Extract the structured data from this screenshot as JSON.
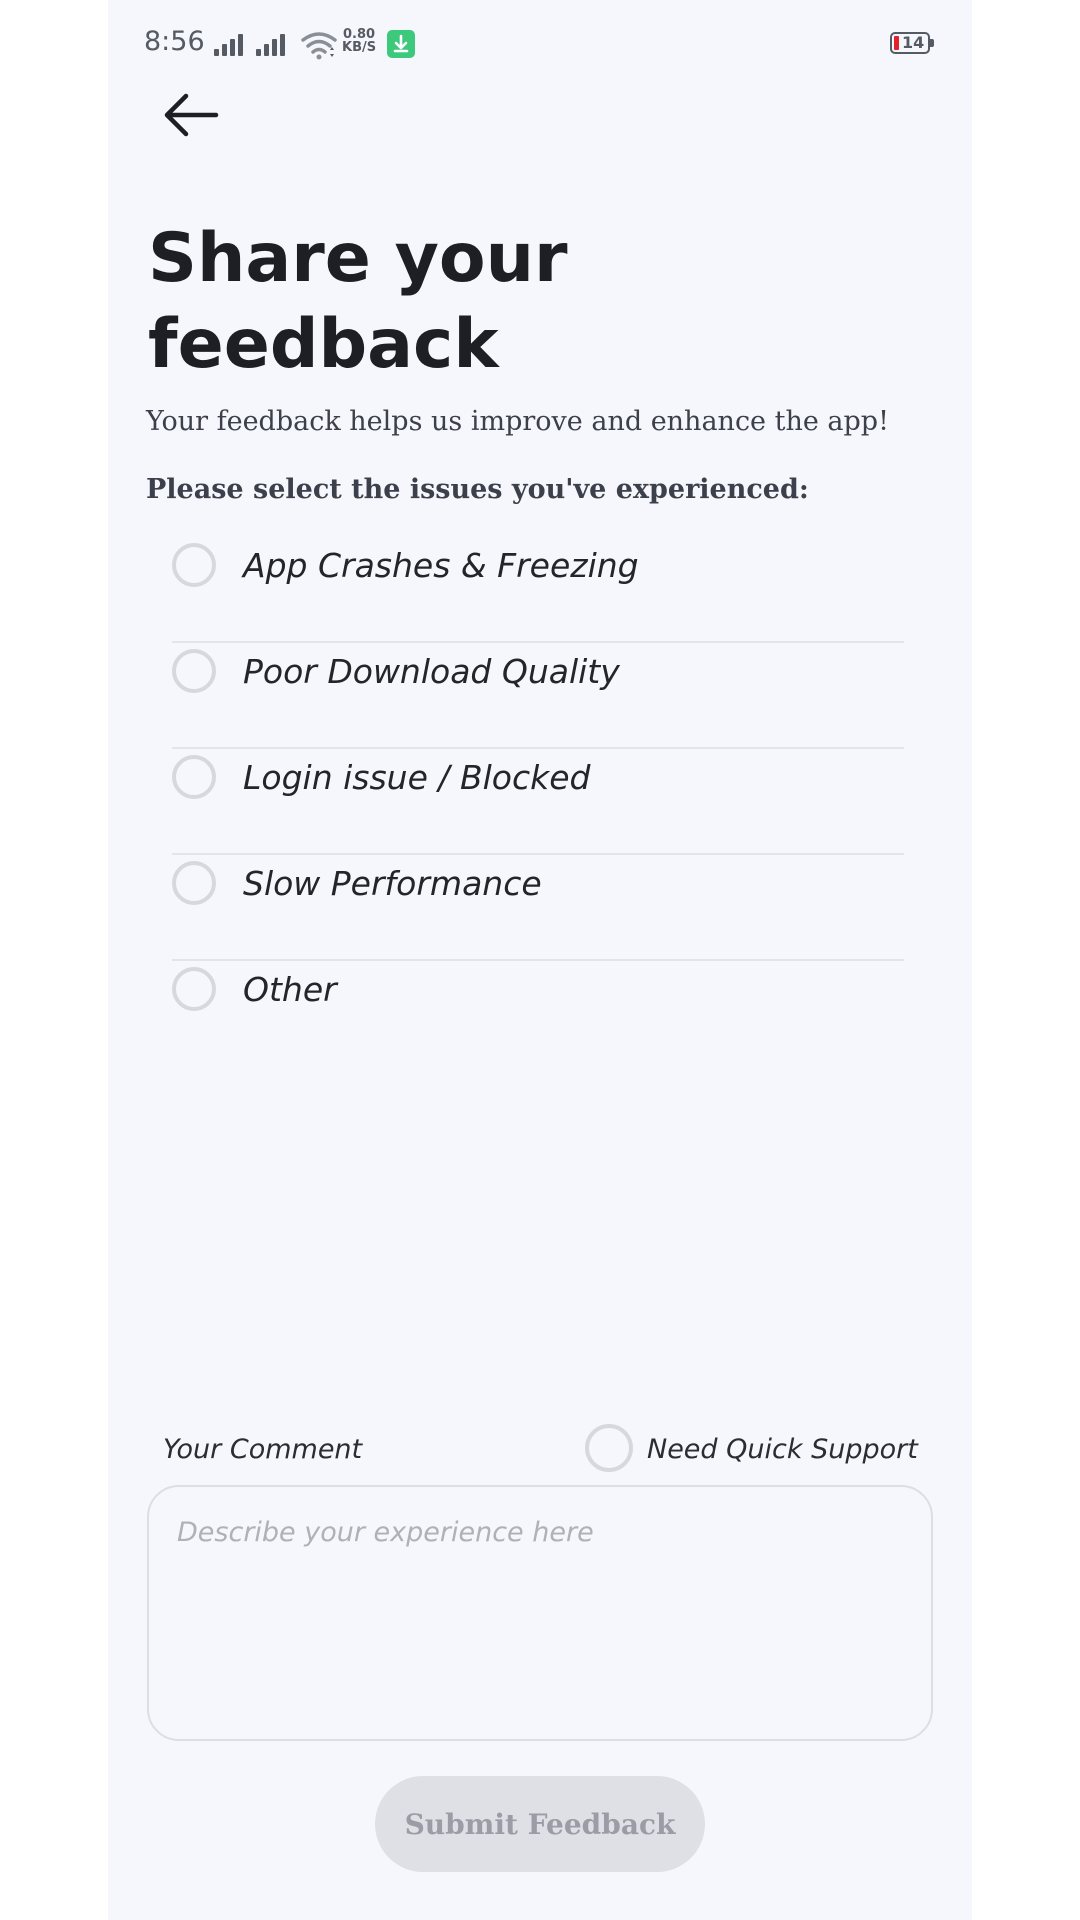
{
  "status_bar": {
    "time": "8:56",
    "speed_value": "0.80",
    "speed_unit": "KB/S",
    "battery_level": "14"
  },
  "header": {
    "back_icon": "arrow-left-icon"
  },
  "title": "Share your feedback",
  "subtitle": "Your feedback helps us improve and enhance the app!",
  "select_prompt": "Please select the issues you've experienced:",
  "issues": [
    {
      "label": "App Crashes & Freezing"
    },
    {
      "label": "Poor Download Quality"
    },
    {
      "label": "Login issue / Blocked"
    },
    {
      "label": "Slow Performance"
    },
    {
      "label": "Other"
    }
  ],
  "comment": {
    "label": "Your Comment",
    "placeholder": "Describe your experience here",
    "value": ""
  },
  "quick_support": {
    "label": "Need Quick Support"
  },
  "submit": {
    "label": "Submit Feedback"
  },
  "colors": {
    "background": "#f6f7fd",
    "radio_border": "#d6d8de",
    "submit_disabled": "#dfe0e5",
    "battery_low": "#e5202e",
    "download_badge": "#3cc97c"
  }
}
